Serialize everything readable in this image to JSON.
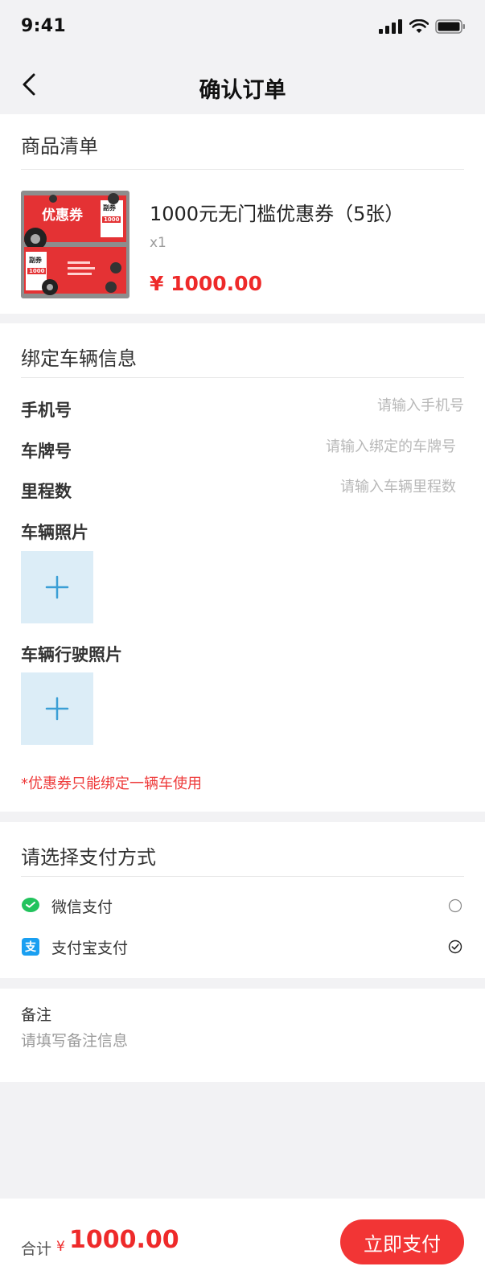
{
  "status_bar": {
    "time": "9:41",
    "icons": [
      "signal-icon",
      "wifi-icon",
      "battery-icon"
    ]
  },
  "nav": {
    "title": "确认订单",
    "back_icon": "chevron-left-icon"
  },
  "product_section": {
    "title": "商品清单",
    "item": {
      "name": "1000元无门槛优惠券（5张）",
      "quantity": "x1",
      "price": "¥ 1000.00",
      "image": {
        "main_label": "优惠券",
        "side_label": "副券",
        "side_amount": "1000",
        "lower_label": "副券",
        "lower_amount": "1000"
      }
    }
  },
  "vehicle_section": {
    "title": "绑定车辆信息",
    "fields": [
      {
        "label": "手机号",
        "placeholder": "请输入手机号",
        "value": ""
      },
      {
        "label": "车牌号",
        "placeholder": "请输入绑定的车牌号",
        "value": ""
      },
      {
        "label": "里程数",
        "placeholder": "请输入车辆里程数",
        "value": ""
      }
    ],
    "photo_label": "车辆照片",
    "license_photo_label": "车辆行驶照片",
    "upload_icon": "plus-icon",
    "notice": "*优惠券只能绑定一辆车使用"
  },
  "payment_section": {
    "title": "请选择支付方式",
    "methods": [
      {
        "label": "微信支付",
        "icon": "wechat-pay-icon",
        "selected": false
      },
      {
        "label": "支付宝支付",
        "icon": "alipay-icon",
        "selected": true
      }
    ]
  },
  "remark": {
    "label": "备注",
    "placeholder": "请填写备注信息",
    "value": ""
  },
  "footer": {
    "total_label": "合计",
    "currency": "¥",
    "amount": "1000.00",
    "pay_button": "立即支付"
  },
  "colors": {
    "accent_red": "#f23535",
    "price_red": "#ee2a2a",
    "upload_bg": "#dcedf7",
    "upload_plus": "#3b9fd6",
    "wechat_green": "#22c35d",
    "alipay_blue": "#1a9ff1"
  }
}
